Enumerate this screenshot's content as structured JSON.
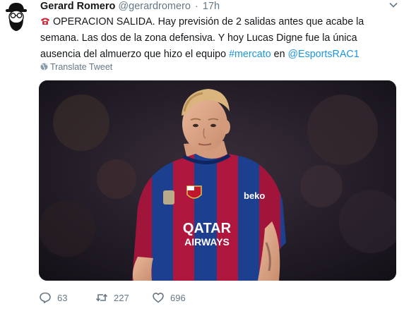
{
  "tweet": {
    "author_name": "Gerard Romero",
    "author_handle": "@gerardromero",
    "separator": "·",
    "time": "17h",
    "text_part1": "OPERACION SALIDA. Hay previsión de 2 salidas antes que acabe la semana. Las dos de la zona defensiva. Y hoy Lucas Digne fue la única ausencia del almuerzo que hizo el equipo ",
    "hashtag": "#mercato",
    "text_part2": " en ",
    "mention": "@EsportsRAC1",
    "translate_label": "Translate Tweet",
    "jersey_sponsor_line1": "QATAR",
    "jersey_sponsor_line2": "AIRWAYS",
    "sleeve_logo": "beko"
  },
  "actions": {
    "replies": "63",
    "retweets": "227",
    "likes": "696"
  },
  "colors": {
    "link": "#1b95e0",
    "secondary_text": "#657786",
    "primary_text": "#14171a"
  },
  "icons": [
    "avatar-icon",
    "chevron-down-icon",
    "phone-emoji-icon",
    "globe-icon",
    "reply-icon",
    "retweet-icon",
    "like-icon"
  ]
}
